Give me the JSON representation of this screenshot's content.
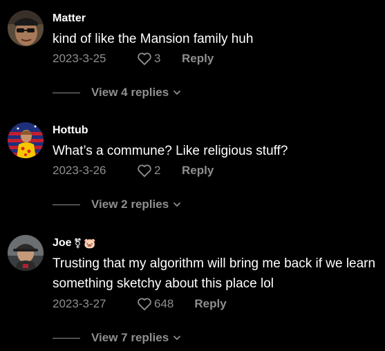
{
  "colors": {
    "background": "#000000",
    "primary_text": "#ffffff",
    "secondary_text": "#8f8f8f"
  },
  "comments": [
    {
      "username": "Matter",
      "badges": [],
      "text": "kind of like the Mansion family huh",
      "date": "2023-3-25",
      "likes": "3",
      "reply_label": "Reply",
      "view_replies": "View 4 replies",
      "avatar_icon": "user-avatar-sunglasses"
    },
    {
      "username": "Hottub",
      "badges": [],
      "text": "What’s a commune? Like religious stuff?",
      "date": "2023-3-26",
      "likes": "2",
      "reply_label": "Reply",
      "view_replies": "View 2 replies",
      "avatar_icon": "user-avatar-flag"
    },
    {
      "username": "Joe",
      "badges": [
        "⚧",
        "🐷"
      ],
      "text": "Trusting that my algorithm will bring me back if we learn something sketchy about this place lol",
      "date": "2023-3-27",
      "likes": "648",
      "reply_label": "Reply",
      "view_replies": "View 7 replies",
      "avatar_icon": "user-avatar-cap"
    }
  ]
}
